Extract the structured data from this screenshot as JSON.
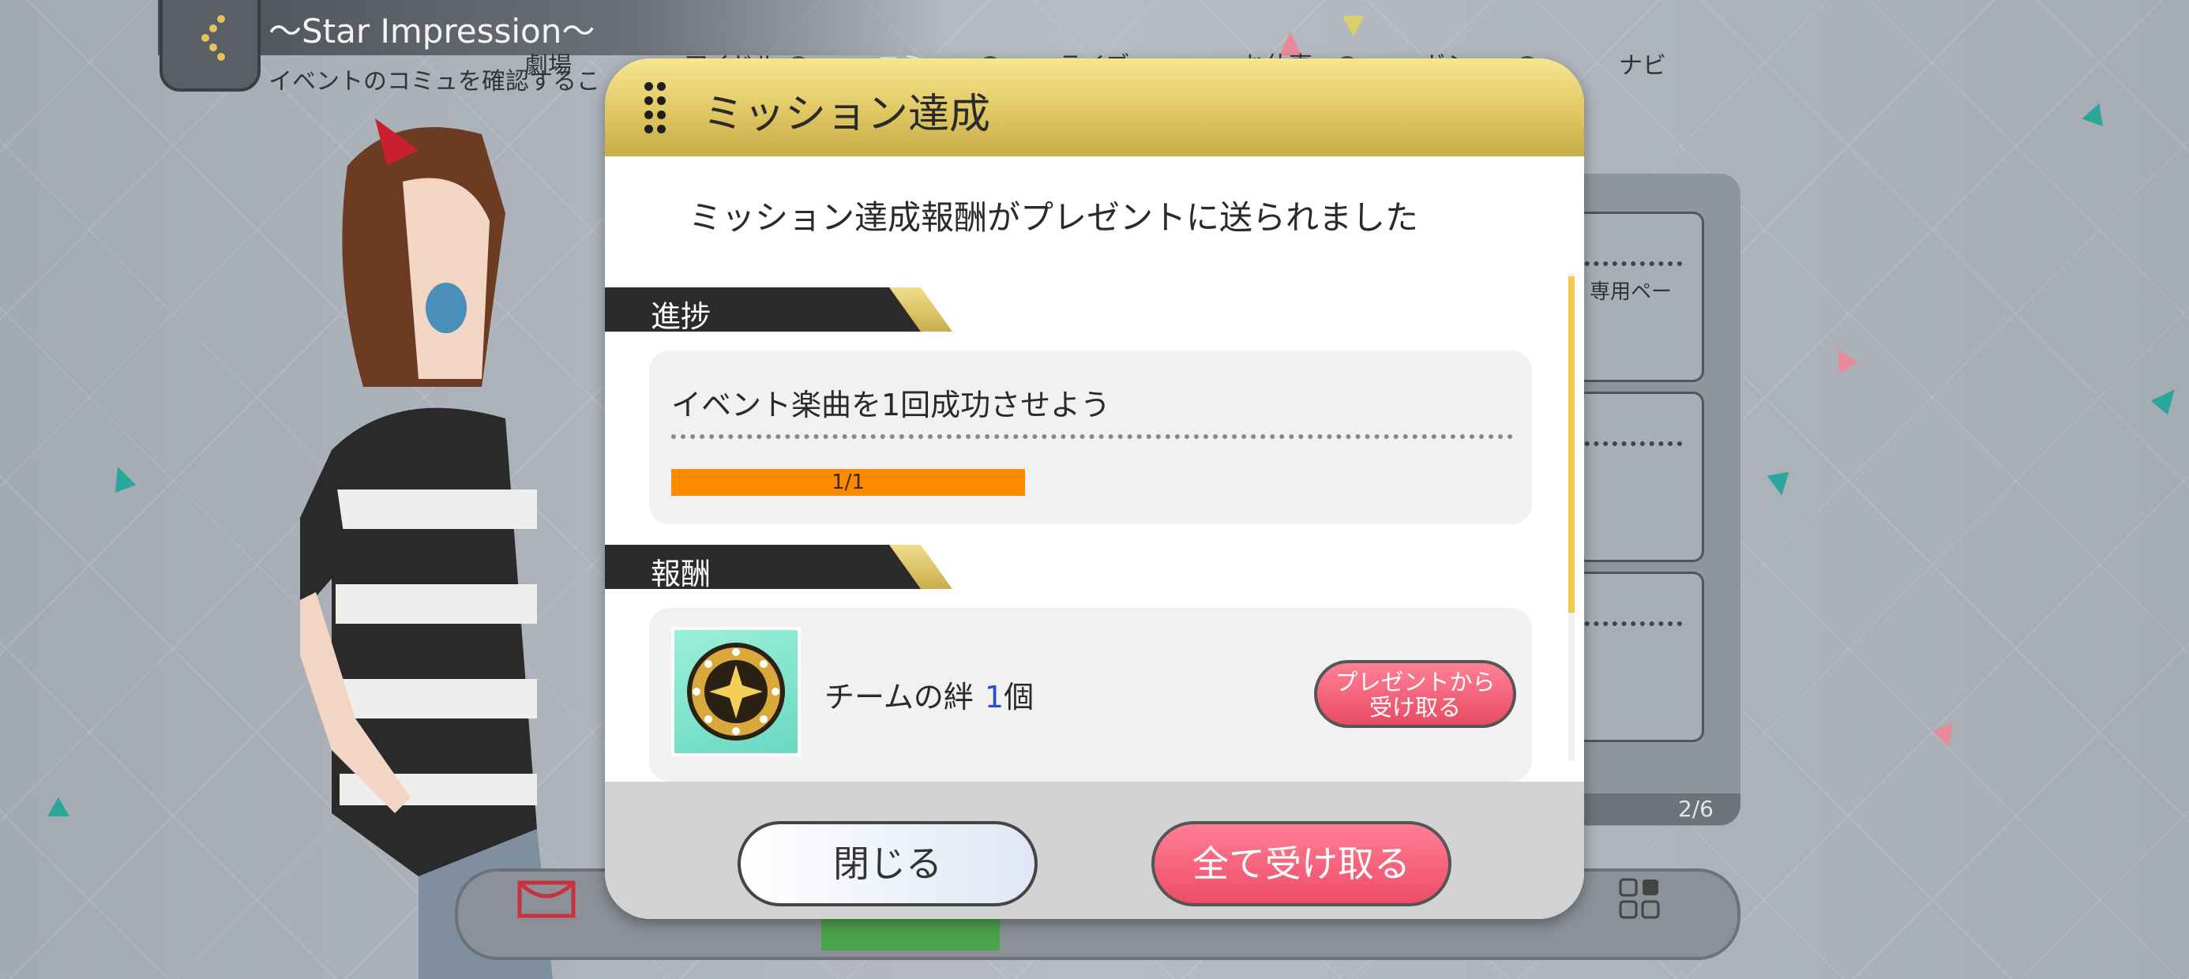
{
  "header": {
    "title": "〜Star Impression〜",
    "subtitle": "イベントのコミュを確認するこ"
  },
  "right_panel": {
    "card1_text": "専用ペー",
    "page_indicator": "2/6"
  },
  "bottom_nav": {
    "items": [
      "劇場",
      "アイドル",
      "コミュ",
      "ライブ",
      "お仕事",
      "ガシャ",
      "ナビ"
    ],
    "active": "コミュ"
  },
  "dialog": {
    "title": "ミッション達成",
    "message": "ミッション達成報酬がプレゼントに送られました",
    "progress_section": "進捗",
    "mission": {
      "text": "イベント楽曲を1回成功させよう",
      "progress_label": "1/1",
      "progress_fraction": 1.0
    },
    "reward_section": "報酬",
    "reward": {
      "name": "チームの絆",
      "count": "1",
      "unit": "個",
      "icon": "team-bond-medal-icon",
      "button": "プレゼントから受け取る",
      "button_line1": "プレゼントから",
      "button_line2": "受け取る"
    },
    "buttons": {
      "close": "閉じる",
      "receive_all": "全て受け取る"
    }
  },
  "colors": {
    "header_gold": "#e0c763",
    "progress_orange": "#ff8a00",
    "button_pink": "#ee4d68",
    "active_nav_green": "#4da34a"
  }
}
